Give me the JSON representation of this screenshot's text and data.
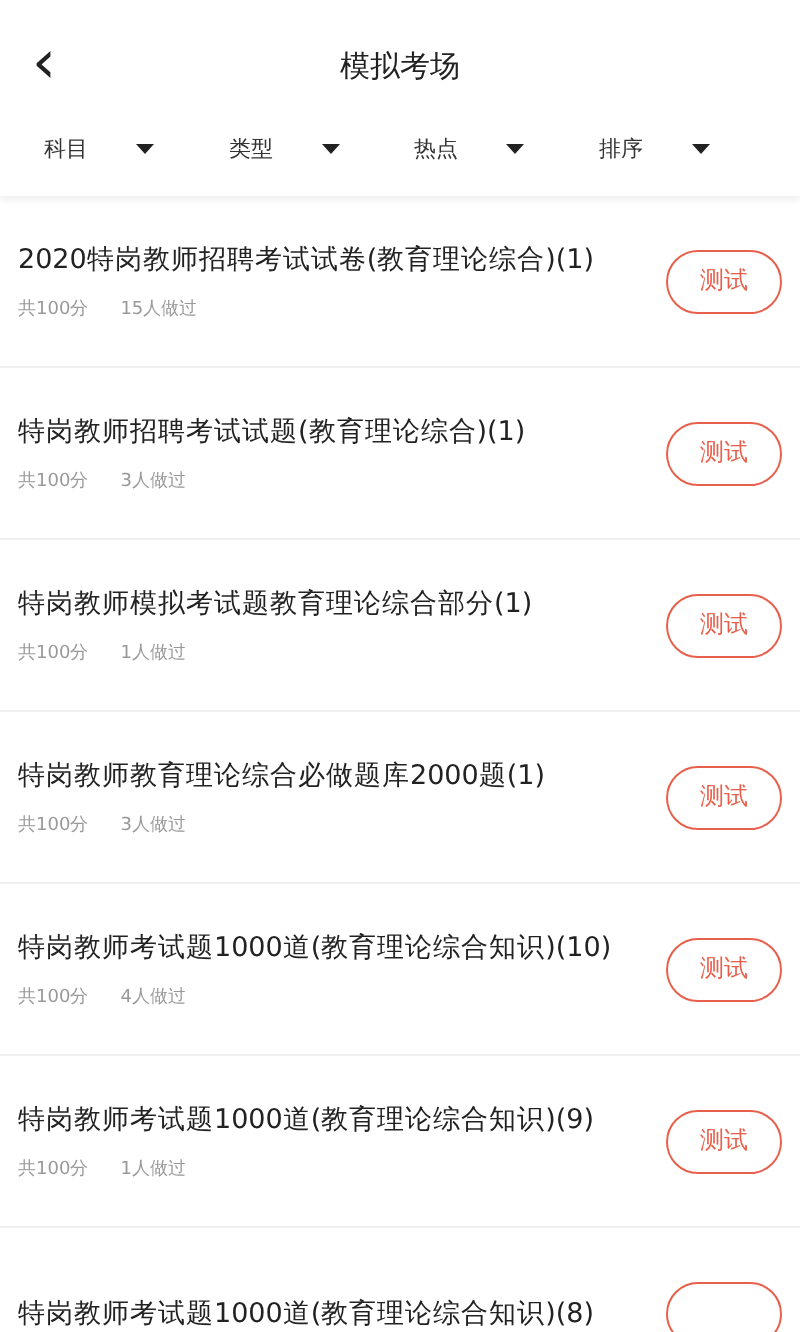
{
  "header": {
    "back": "‹",
    "title": "模拟考场"
  },
  "filters": [
    {
      "label": "科目"
    },
    {
      "label": "类型"
    },
    {
      "label": "热点"
    },
    {
      "label": "排序"
    }
  ],
  "exams": [
    {
      "title": "2020特岗教师招聘考试试卷(教育理论综合)(1)",
      "score": "共100分",
      "takers": "15人做过",
      "action": "测试"
    },
    {
      "title": "特岗教师招聘考试试题(教育理论综合)(1)",
      "score": "共100分",
      "takers": "3人做过",
      "action": "测试"
    },
    {
      "title": "特岗教师模拟考试题教育理论综合部分(1)",
      "score": "共100分",
      "takers": "1人做过",
      "action": "测试"
    },
    {
      "title": "特岗教师教育理论综合必做题库2000题(1)",
      "score": "共100分",
      "takers": "3人做过",
      "action": "测试"
    },
    {
      "title": "特岗教师考试题1000道(教育理论综合知识)(10)",
      "score": "共100分",
      "takers": "4人做过",
      "action": "测试"
    },
    {
      "title": "特岗教师考试题1000道(教育理论综合知识)(9)",
      "score": "共100分",
      "takers": "1人做过",
      "action": "测试"
    },
    {
      "title": "特岗教师考试题1000道(教育理论综合知识)(8)"
    }
  ]
}
